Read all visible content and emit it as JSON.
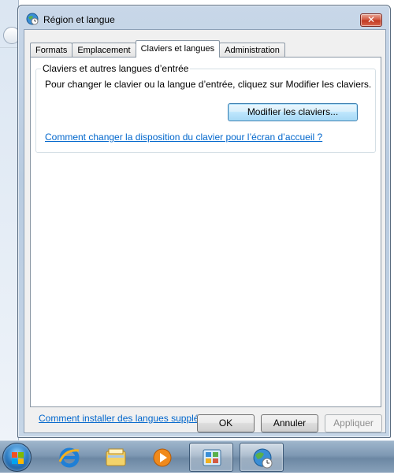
{
  "window": {
    "title": "Région et langue",
    "close_label": "✕"
  },
  "tabs": [
    {
      "label": "Formats"
    },
    {
      "label": "Emplacement"
    },
    {
      "label": "Claviers et langues"
    },
    {
      "label": "Administration"
    }
  ],
  "active_tab": "Claviers et langues",
  "keyboards": {
    "group_title": "Claviers et autres langues d’entrée",
    "description": "Pour changer le clavier ou la langue d’entrée, cliquez sur Modifier les claviers.",
    "change_button": "Modifier les claviers...",
    "welcome_link": "Comment changer la disposition du clavier pour l’écran d’accueil ?"
  },
  "install_languages_link": "Comment installer des langues supplémentaires ?",
  "footer": {
    "ok": "OK",
    "cancel": "Annuler",
    "apply": "Appliquer"
  },
  "taskbar": {
    "items": [
      {
        "icon": "windows-start-orb"
      },
      {
        "icon": "internet-explorer-icon"
      },
      {
        "icon": "file-explorer-icon"
      },
      {
        "icon": "media-player-icon"
      },
      {
        "icon": "control-panel-icon"
      },
      {
        "icon": "region-language-icon"
      }
    ]
  },
  "colors": {
    "link": "#0066cc",
    "close_button": "#c23a22",
    "focused_button_border": "#3c7fb1"
  }
}
